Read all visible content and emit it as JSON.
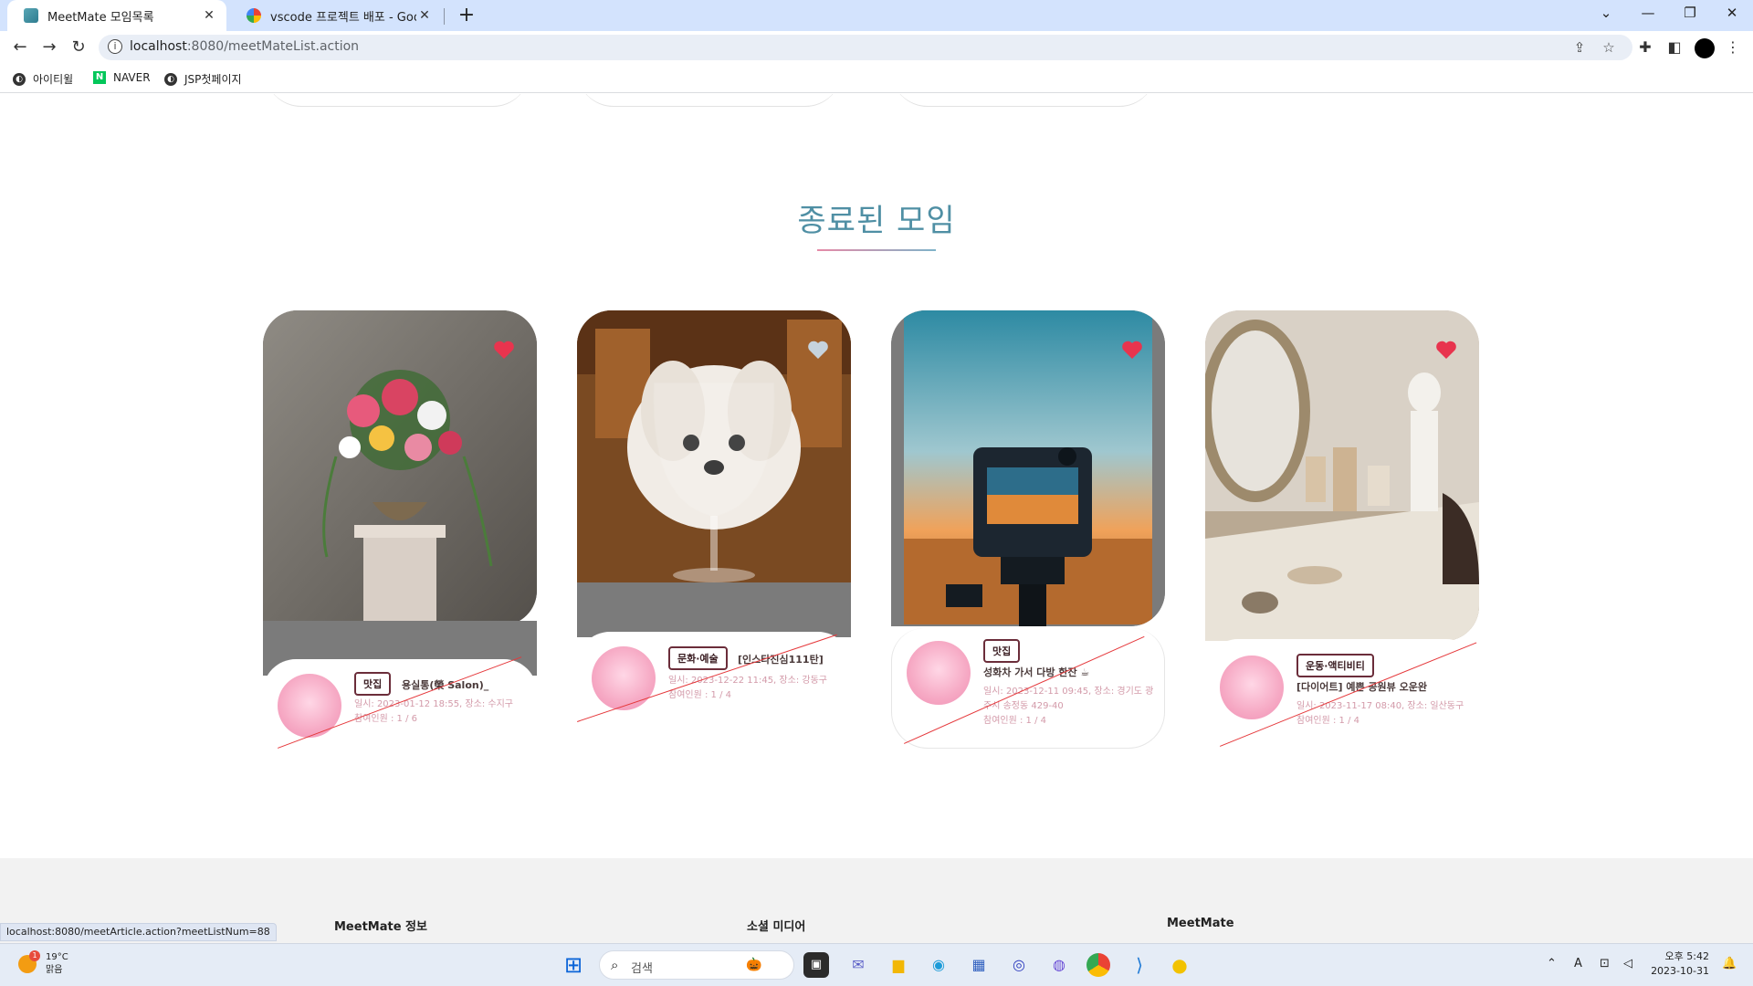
{
  "browser": {
    "tabs": [
      {
        "title": "MeetMate 모임목록",
        "active": true
      },
      {
        "title": "vscode 프로젝트 배포 - Google",
        "active": false
      }
    ],
    "address": {
      "host": "localhost",
      "rest": ":8080/meetMateList.action"
    },
    "bookmarks": [
      "아이티윌",
      "NAVER",
      "JSP첫페이지"
    ]
  },
  "page": {
    "section_title": "종료된 모임",
    "cards": [
      {
        "category": "맛집",
        "title": "용실통(榮 Salon)_",
        "meta_line1": "일시: 2023-01-12 18:55, 장소: 수지구",
        "meta_line2": "참여인원 : 1 / 6",
        "heart": "red",
        "photo": "flower-vase"
      },
      {
        "category": "문화·예술",
        "title": "[인스타진심111탄]",
        "meta_line1": "일시: 2023-12-22 11:45, 장소: 강동구",
        "meta_line2": "참여인원 : 1 / 4",
        "heart": "grey",
        "photo": "dog-wineglass"
      },
      {
        "category": "맛집",
        "title": "성화차 가서 다방 한잔 ☕",
        "meta_line1": "일시: 2023-12-11 09:45, 장소: 경기도 광",
        "meta_line1b": "주시 송정동 429-40",
        "meta_line2": "참여인원 : 1 / 4",
        "heart": "red",
        "photo": "camera-sunset"
      },
      {
        "category": "운동·액티비티",
        "title": "[다이어트] 예쁜 공원뷰 오운완",
        "meta_line1": "일시: 2023-11-17 08:40, 장소: 일산동구",
        "meta_line2": "참여인원 : 1 / 4",
        "heart": "red",
        "photo": "pottery-studio"
      }
    ],
    "footer_headings": [
      "MeetMate 정보",
      "소셜 미디어",
      "MeetMate"
    ]
  },
  "status_url": "localhost:8080/meetArticle.action?meetListNum=88",
  "taskbar": {
    "weather": {
      "temp": "19°C",
      "condition": "맑음",
      "badge": "1"
    },
    "search_placeholder": "검색",
    "clock": {
      "time": "오후 5:42",
      "date": "2023-10-31"
    },
    "tray_lang": "A"
  },
  "colors": {
    "title": "#4f8fa4",
    "heart_red": "#e8344e",
    "heart_grey": "#c6d3dd",
    "strike": "#e5383b",
    "category_border": "#6b2d3a"
  }
}
